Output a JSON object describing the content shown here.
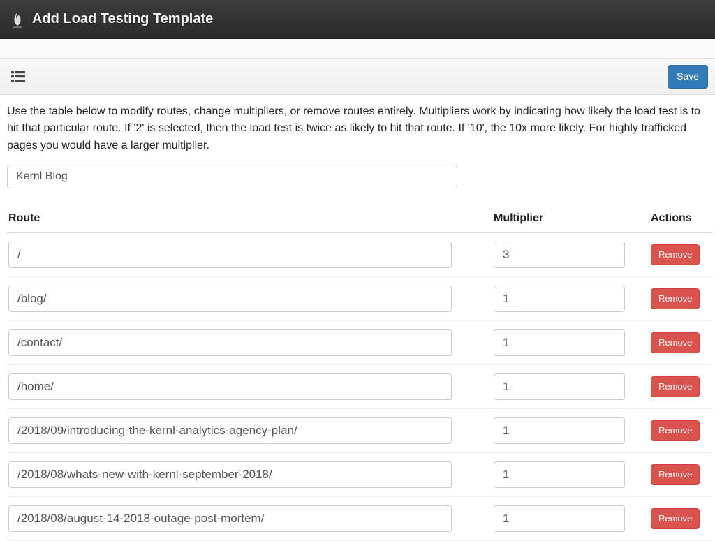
{
  "navbar": {
    "title": "Add Load Testing Template"
  },
  "toolbar": {
    "save_label": "Save"
  },
  "main": {
    "help_text": "Use the table below to modify routes, change multipliers, or remove routes entirely. Multipliers work by indicating how likely the load test is to hit that particular route. If '2' is selected, then the load test is twice as likely to hit that route. If '10', the 10x more likely. For highly trafficked pages you would have a larger multiplier.",
    "template_name": "Kernl Blog"
  },
  "table": {
    "headers": {
      "route": "Route",
      "multiplier": "Multiplier",
      "actions": "Actions"
    },
    "remove_label": "Remove",
    "rows": [
      {
        "route": "/",
        "multiplier": "3"
      },
      {
        "route": "/blog/",
        "multiplier": "1"
      },
      {
        "route": "/contact/",
        "multiplier": "1"
      },
      {
        "route": "/home/",
        "multiplier": "1"
      },
      {
        "route": "/2018/09/introducing-the-kernl-analytics-agency-plan/",
        "multiplier": "1"
      },
      {
        "route": "/2018/08/whats-new-with-kernl-september-2018/",
        "multiplier": "1"
      },
      {
        "route": "/2018/08/august-14-2018-outage-post-mortem/",
        "multiplier": "1"
      }
    ]
  }
}
